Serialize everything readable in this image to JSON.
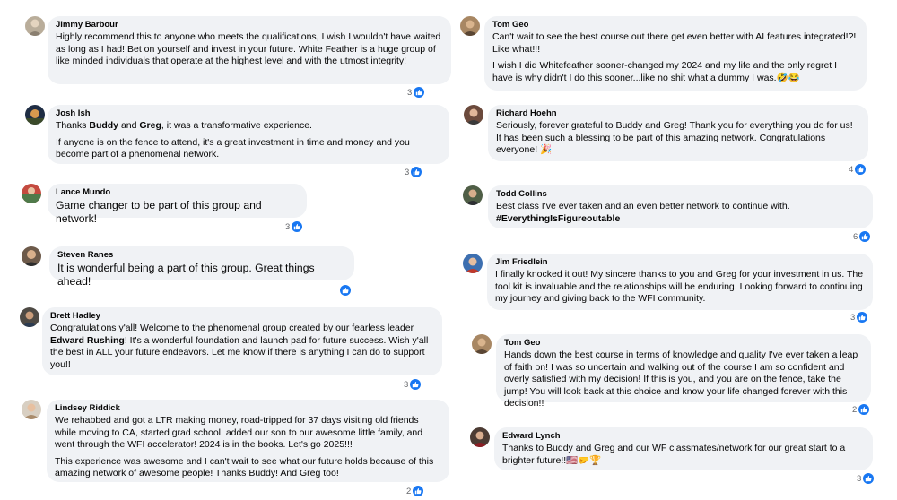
{
  "comments_left": [
    {
      "name": "Jimmy Barbour",
      "paragraphs": [
        "Highly recommend this to anyone who meets the qualifications, I wish I wouldn't have waited as long as I had! Bet on yourself and invest in your future. White Feather is a huge group of like minded individuals that operate at the highest level and with the utmost integrity!"
      ],
      "reactions": "3"
    },
    {
      "name": "Josh Ish",
      "p1_pre": "Thanks ",
      "p1_b1": "Buddy",
      "p1_mid": " and ",
      "p1_b2": "Greg",
      "p1_post": ", it was a transformative experience.",
      "p2": "If anyone is on the fence to attend, it's a great investment in time and money and you become part of a phenomenal network.",
      "reactions": "3"
    },
    {
      "name": "Lance Mundo",
      "paragraphs": [
        "Game changer to be part of this group and network!"
      ],
      "reactions": "3"
    },
    {
      "name": "Steven Ranes",
      "paragraphs": [
        "It is wonderful being a part of this group. Great things ahead!"
      ],
      "reactions": ""
    },
    {
      "name": "Brett Hadley",
      "p1_pre": "Congratulations y'all! Welcome to the phenomenal group created by our fearless leader ",
      "p1_b1": "Edward Rushing",
      "p1_post": "! It's a wonderful foundation and launch pad for future success. Wish y'all the best in ALL your future endeavors. Let me know if there is anything I can do to support you!!",
      "reactions": "3"
    },
    {
      "name": "Lindsey Riddick",
      "paragraphs": [
        "We rehabbed and got a LTR making money, road-tripped for 37 days visiting old friends while moving to CA, started grad school, added our son to our awesome little family, and went through the WFI accelerator! 2024 is in the books. Let's go 2025!!!",
        "This experience was awesome and I can't wait to see what our future holds because of this amazing network of awesome people! Thanks Buddy! And Greg too!"
      ],
      "reactions": "2"
    }
  ],
  "comments_right": [
    {
      "name": "Tom Geo",
      "paragraphs": [
        "Can't wait to see the best course out there get even better with AI features integrated!?! Like what!!!",
        "I wish I did Whitefeather sooner-changed my 2024 and my life and the only regret I have is why didn't I do this sooner...like no shit what a dummy I was.🤣😂"
      ],
      "reactions": ""
    },
    {
      "name": "Richard Hoehn",
      "paragraphs": [
        "Seriously, forever grateful to Buddy and Greg! Thank you for everything you do for us! It has been such a blessing to be part of this amazing network. Congratulations everyone! 🎉"
      ],
      "reactions": "4"
    },
    {
      "name": "Todd Collins",
      "p1": "Best class I've ever taken and an even better network to continue with.",
      "p1_b": "#EverythingIsFigureoutable",
      "reactions": "6"
    },
    {
      "name": "Jim Friedlein",
      "paragraphs": [
        "I finally knocked it out! My sincere thanks to you and Greg for your investment in us. The tool kit is invaluable and the relationships will be enduring. Looking forward to continuing my journey and giving back to the WFI community."
      ],
      "reactions": "3"
    },
    {
      "name": "Tom Geo",
      "paragraphs": [
        "Hands down the best course in terms of knowledge and quality I've ever taken a leap of faith on! I was so uncertain and walking out of the course I am so confident and overly satisfied with my decision! If this is you, and you are on the fence, take the jump! You will look back at this choice and know your life changed forever with this decision!!"
      ],
      "reactions": "2"
    },
    {
      "name": "Edward Lynch",
      "paragraphs": [
        "Thanks to Buddy and Greg and our WF classmates/network for our great start to a brighter future!!🇺🇸🤛🏆"
      ],
      "reactions": "3"
    }
  ],
  "colors": {
    "bubble": "#f0f2f5",
    "like": "#1877f2",
    "count": "#65676b"
  },
  "icons": {
    "reaction": "like-thumbs-up-icon"
  }
}
